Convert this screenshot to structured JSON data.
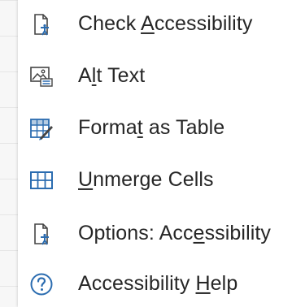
{
  "menu": {
    "items": [
      {
        "id": "check-accessibility",
        "pre": "Check ",
        "key": "A",
        "post": "ccessibility",
        "icon": "accessibility-checker-icon"
      },
      {
        "id": "alt-text",
        "pre": "A",
        "key": "l",
        "post": "t Text",
        "icon": "alt-text-icon"
      },
      {
        "id": "format-as-table",
        "pre": "Forma",
        "key": "t",
        "post": " as Table",
        "icon": "format-table-icon"
      },
      {
        "id": "unmerge-cells",
        "pre": "",
        "key": "U",
        "post": "nmerge Cells",
        "icon": "unmerge-cells-icon"
      },
      {
        "id": "options-accessibility",
        "pre": "Options: Acc",
        "key": "e",
        "post": "ssibility",
        "icon": "accessibility-options-icon"
      },
      {
        "id": "accessibility-help",
        "pre": "Accessibility ",
        "key": "H",
        "post": "elp",
        "icon": "help-icon"
      }
    ]
  },
  "colors": {
    "text": "#262626",
    "icon_dark": "#444444",
    "icon_blue": "#2b6cb0"
  }
}
